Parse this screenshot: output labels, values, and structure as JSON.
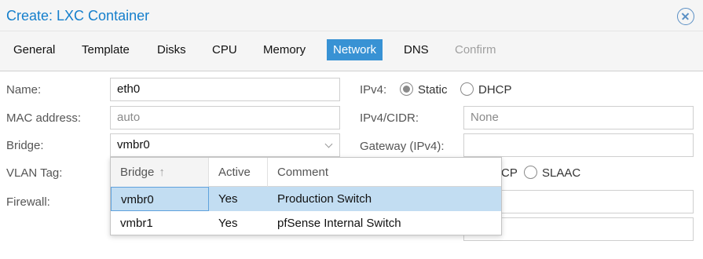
{
  "window": {
    "title": "Create: LXC Container",
    "close_icon": "close-circle-icon"
  },
  "tabs": [
    {
      "label": "General",
      "state": "normal"
    },
    {
      "label": "Template",
      "state": "normal"
    },
    {
      "label": "Disks",
      "state": "normal"
    },
    {
      "label": "CPU",
      "state": "normal"
    },
    {
      "label": "Memory",
      "state": "normal"
    },
    {
      "label": "Network",
      "state": "active"
    },
    {
      "label": "DNS",
      "state": "normal"
    },
    {
      "label": "Confirm",
      "state": "disabled"
    }
  ],
  "form": {
    "left": {
      "name_label": "Name:",
      "name_value": "eth0",
      "mac_label": "MAC address:",
      "mac_placeholder": "auto",
      "bridge_label": "Bridge:",
      "bridge_value": "vmbr0",
      "vlan_label": "VLAN Tag:",
      "firewall_label": "Firewall:"
    },
    "right": {
      "ipv4_label": "IPv4:",
      "ipv4_static": "Static",
      "ipv4_dhcp": "DHCP",
      "ipv4_mode": "Static",
      "ipv4_cidr_label": "IPv4/CIDR:",
      "ipv4_cidr_value": "None",
      "gateway_label": "Gateway (IPv4):",
      "ipv6_partial_dhcp": "CP",
      "ipv6_slaac": "SLAAC"
    }
  },
  "bridge_dropdown": {
    "columns": [
      "Bridge",
      "Active",
      "Comment"
    ],
    "sort_icon": "sort-ascending-icon",
    "rows": [
      {
        "bridge": "vmbr0",
        "active": "Yes",
        "comment": "Production Switch",
        "selected": true
      },
      {
        "bridge": "vmbr1",
        "active": "Yes",
        "comment": "pfSense Internal Switch",
        "selected": false
      }
    ]
  },
  "colors": {
    "accent": "#3892d4",
    "title": "#157fcc",
    "selected_row": "#c2ddf2"
  }
}
